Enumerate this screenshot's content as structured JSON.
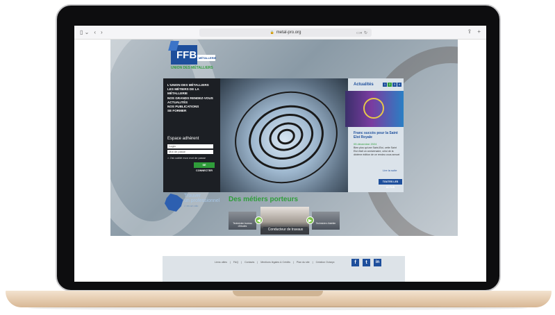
{
  "browser": {
    "url": "metal-pro.org",
    "toolbar_left": [
      "▯ ⌄",
      "‹",
      "›"
    ],
    "toolbar_right": [
      "⇪",
      "+"
    ],
    "lock": "🔒",
    "reader": "▭◐",
    "reload": "↻"
  },
  "logo": {
    "brand": "FFB",
    "sub": "MÉTALLERIE",
    "union": "UNION DES MÉTALLIERS"
  },
  "menu": {
    "items": [
      "L'UNION DES MÉTALLIERS",
      "LES MÉTIERS DE LA MÉTALLERIE",
      "NOS GRANDS RENDEZ-VOUS",
      "ACTUALITÉS",
      "NOS PUBLICATIONS",
      "SE FORMER"
    ]
  },
  "login": {
    "title": "Espace adhérent",
    "login_placeholder": "Login",
    "password_placeholder": "Mot de passe",
    "forgot": "> J'ai oublié mon mot de passe",
    "submit": "SE CONNECTER"
  },
  "news": {
    "title": "Actualités",
    "pager": [
      "1",
      "2",
      "3",
      "4"
    ],
    "headline": "Franc succès pour la Saint Eloi Royale",
    "date": "05 décembre 2024",
    "body": "Bien plus qu'une Saint-Eloi, cette Saint Eloi était un anniversaire, celui de la dixième édition de ce rendez-vous annuel",
    "read_more": "Lire la suite",
    "all_news": "TOUTES LES ACTUS"
  },
  "finder": {
    "line1": "Trouver",
    "line2": "un professionnel",
    "line3": "> en un clic"
  },
  "careers": {
    "title": "Des métiers porteurs",
    "slides": [
      "Technicien bureau d'études",
      "Conducteur de travaux",
      "Technicien d'atelier"
    ],
    "prev": "◀",
    "next": "▶"
  },
  "footer": {
    "links": [
      "Liens utiles",
      "FAQ",
      "Contacts",
      "Mentions légales & Crédits",
      "Plan du site",
      "Création Octaryx"
    ],
    "social": [
      "f",
      "t",
      "in"
    ]
  },
  "colors": {
    "brand_blue": "#1e4f9c",
    "brand_green": "#2f9d3a"
  }
}
